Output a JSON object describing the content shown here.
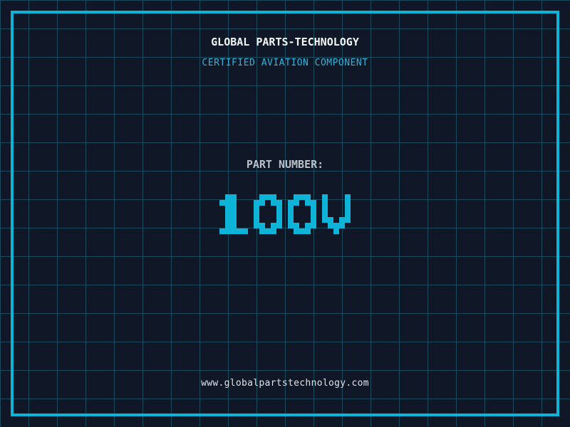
{
  "colors": {
    "background": "#101827",
    "grid_line": "#1b4a5e",
    "frame": "#0db4d8",
    "title": "#f2f5f5",
    "subtitle": "#2fb4da",
    "label": "#b9c2cb",
    "part_number": "#0db4d8",
    "url": "#dde3e6"
  },
  "header": {
    "title": "GLOBAL PARTS-TECHNOLOGY",
    "subtitle": "CERTIFIED AVIATION COMPONENT"
  },
  "main": {
    "part_number_label": "PART NUMBER:",
    "part_number": "100V"
  },
  "footer": {
    "website_url": "www.globalpartstechnology.com"
  }
}
